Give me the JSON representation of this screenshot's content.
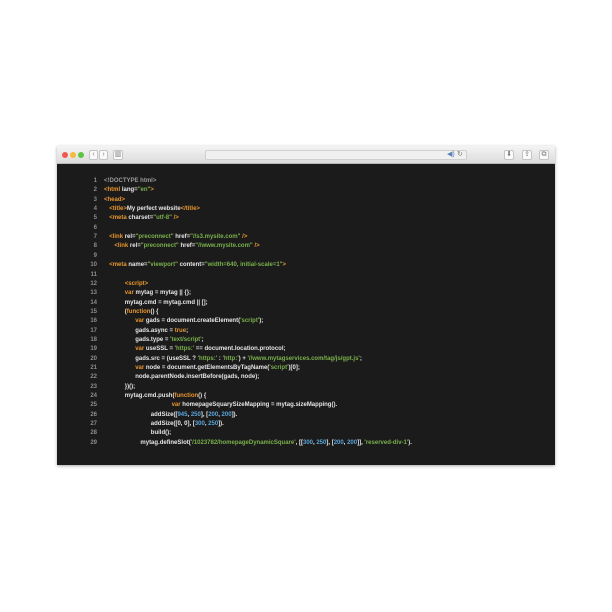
{
  "browser": {
    "controls": {
      "back": "‹",
      "forward": "›",
      "sidebar": "▥",
      "audio": "◀)",
      "reload": "↻",
      "download": "⬇",
      "share": "⇪",
      "tabs": "⧉"
    }
  },
  "colors": {
    "tag": "#e8962e",
    "string": "#79b14b",
    "number": "#5aa6d8",
    "text": "#e6e6e6",
    "line_number": "#8d8d8d",
    "background": "#1c1b1c"
  },
  "code_lines": [
    {
      "n": "1",
      "indent": 0,
      "tokens": [
        {
          "t": "doctype",
          "v": "<!DOCTYPE html>"
        }
      ]
    },
    {
      "n": "2",
      "indent": 0,
      "tokens": [
        {
          "t": "tag",
          "v": "<html "
        },
        {
          "t": "attr",
          "v": "lang="
        },
        {
          "t": "str",
          "v": "\"en\""
        },
        {
          "t": "tag",
          "v": ">"
        }
      ]
    },
    {
      "n": "3",
      "indent": 0,
      "tokens": [
        {
          "t": "tag",
          "v": "<head>"
        }
      ]
    },
    {
      "n": "4",
      "indent": 1,
      "tokens": [
        {
          "t": "tag",
          "v": "<title>"
        },
        {
          "t": "plain",
          "v": "My perfect website"
        },
        {
          "t": "tag",
          "v": "</title>"
        }
      ]
    },
    {
      "n": "5",
      "indent": 1,
      "tokens": [
        {
          "t": "tag",
          "v": "<meta "
        },
        {
          "t": "attr",
          "v": "charset="
        },
        {
          "t": "str",
          "v": "\"utf-8\""
        },
        {
          "t": "tag",
          "v": " />"
        }
      ]
    },
    {
      "n": "6",
      "indent": 0,
      "tokens": []
    },
    {
      "n": "7",
      "indent": 1,
      "tokens": [
        {
          "t": "tag",
          "v": "<link "
        },
        {
          "t": "attr",
          "v": "rel="
        },
        {
          "t": "str",
          "v": "\"preconnect\""
        },
        {
          "t": "attr",
          "v": " href="
        },
        {
          "t": "str",
          "v": "\"//s3.mysite.com\""
        },
        {
          "t": "tag",
          "v": " />"
        }
      ]
    },
    {
      "n": "8",
      "indent": 2,
      "tokens": [
        {
          "t": "tag",
          "v": "<link "
        },
        {
          "t": "attr",
          "v": "rel="
        },
        {
          "t": "str",
          "v": "\"preconnect\""
        },
        {
          "t": "attr",
          "v": " href="
        },
        {
          "t": "str",
          "v": "\"//www.mysite.com\""
        },
        {
          "t": "tag",
          "v": " />"
        }
      ]
    },
    {
      "n": "9",
      "indent": 0,
      "tokens": []
    },
    {
      "n": "10",
      "indent": 1,
      "tokens": [
        {
          "t": "tag",
          "v": "<meta "
        },
        {
          "t": "attr",
          "v": "name="
        },
        {
          "t": "str",
          "v": "\"viewport\""
        },
        {
          "t": "attr",
          "v": " content="
        },
        {
          "t": "str",
          "v": "\"width=640, initial-scale=1\""
        },
        {
          "t": "tag",
          "v": ">"
        }
      ]
    },
    {
      "n": "11",
      "indent": 0,
      "tokens": []
    },
    {
      "n": "12",
      "indent": 4,
      "tokens": [
        {
          "t": "tag",
          "v": "<script>"
        }
      ]
    },
    {
      "n": "13",
      "indent": 4,
      "tokens": [
        {
          "t": "kw",
          "v": "var "
        },
        {
          "t": "plain",
          "v": "mytag = mytag || {};"
        }
      ]
    },
    {
      "n": "14",
      "indent": 4,
      "tokens": [
        {
          "t": "plain",
          "v": "mytag.cmd = mytag.cmd || [];"
        }
      ]
    },
    {
      "n": "15",
      "indent": 4,
      "tokens": [
        {
          "t": "plain",
          "v": "("
        },
        {
          "t": "kw",
          "v": "function"
        },
        {
          "t": "plain",
          "v": "() {"
        }
      ]
    },
    {
      "n": "16",
      "indent": 6,
      "tokens": [
        {
          "t": "kw",
          "v": "var "
        },
        {
          "t": "plain",
          "v": "gads = document.createElement("
        },
        {
          "t": "str",
          "v": "'script'"
        },
        {
          "t": "plain",
          "v": ");"
        }
      ]
    },
    {
      "n": "17",
      "indent": 6,
      "tokens": [
        {
          "t": "plain",
          "v": "gads.async = "
        },
        {
          "t": "kw",
          "v": "true"
        },
        {
          "t": "plain",
          "v": ";"
        }
      ]
    },
    {
      "n": "18",
      "indent": 6,
      "tokens": [
        {
          "t": "plain",
          "v": "gads.type = "
        },
        {
          "t": "str",
          "v": "'text/script'"
        },
        {
          "t": "plain",
          "v": ";"
        }
      ]
    },
    {
      "n": "19",
      "indent": 6,
      "tokens": [
        {
          "t": "kw",
          "v": "var "
        },
        {
          "t": "plain",
          "v": "useSSL = "
        },
        {
          "t": "str",
          "v": "'https:'"
        },
        {
          "t": "plain",
          "v": " == document.location.protocol;"
        }
      ]
    },
    {
      "n": "20",
      "indent": 6,
      "tokens": [
        {
          "t": "plain",
          "v": "gads.src = (useSSL ? "
        },
        {
          "t": "str",
          "v": "'https:'"
        },
        {
          "t": "plain",
          "v": " : "
        },
        {
          "t": "str",
          "v": "'http:'"
        },
        {
          "t": "plain",
          "v": ") + "
        },
        {
          "t": "str",
          "v": "'//www.mytagservices.com/tag/js/gpt.js'"
        },
        {
          "t": "plain",
          "v": ";"
        }
      ]
    },
    {
      "n": "21",
      "indent": 6,
      "tokens": [
        {
          "t": "kw",
          "v": "var "
        },
        {
          "t": "plain",
          "v": "node = document.getElementsByTagName("
        },
        {
          "t": "str",
          "v": "'script'"
        },
        {
          "t": "plain",
          "v": ")[0];"
        }
      ]
    },
    {
      "n": "22",
      "indent": 6,
      "tokens": [
        {
          "t": "plain",
          "v": "node.parentNode.insertBefore(gads, node);"
        }
      ]
    },
    {
      "n": "23",
      "indent": 4,
      "tokens": [
        {
          "t": "plain",
          "v": "})();"
        }
      ]
    },
    {
      "n": "24",
      "indent": 4,
      "tokens": [
        {
          "t": "plain",
          "v": "mytag.cmd.push("
        },
        {
          "t": "kw",
          "v": "function"
        },
        {
          "t": "plain",
          "v": "() {"
        }
      ]
    },
    {
      "n": "25",
      "indent": 13,
      "tokens": [
        {
          "t": "kw",
          "v": "var "
        },
        {
          "t": "plain",
          "v": "homepageSquarySizeMapping = mytag.sizeMapping()."
        }
      ]
    },
    {
      "n": "26",
      "indent": 9,
      "tokens": [
        {
          "t": "plain",
          "v": "addSize(["
        },
        {
          "t": "num",
          "v": "945"
        },
        {
          "t": "plain",
          "v": ", "
        },
        {
          "t": "num",
          "v": "250"
        },
        {
          "t": "plain",
          "v": "], ["
        },
        {
          "t": "num",
          "v": "200"
        },
        {
          "t": "plain",
          "v": ", "
        },
        {
          "t": "num",
          "v": "200"
        },
        {
          "t": "plain",
          "v": "])."
        }
      ]
    },
    {
      "n": "27",
      "indent": 9,
      "tokens": [
        {
          "t": "plain",
          "v": "addSize([0, 0], ["
        },
        {
          "t": "num",
          "v": "300"
        },
        {
          "t": "plain",
          "v": ", "
        },
        {
          "t": "num",
          "v": "250"
        },
        {
          "t": "plain",
          "v": "])."
        }
      ]
    },
    {
      "n": "28",
      "indent": 9,
      "tokens": [
        {
          "t": "plain",
          "v": "build();"
        }
      ]
    },
    {
      "n": "29",
      "indent": 7,
      "tokens": [
        {
          "t": "plain",
          "v": "mytag.defineSlot("
        },
        {
          "t": "str",
          "v": "'/1023782/homepageDynamicSquare'"
        },
        {
          "t": "plain",
          "v": ", [["
        },
        {
          "t": "num",
          "v": "300"
        },
        {
          "t": "plain",
          "v": ", "
        },
        {
          "t": "num",
          "v": "250"
        },
        {
          "t": "plain",
          "v": "], ["
        },
        {
          "t": "num",
          "v": "200"
        },
        {
          "t": "plain",
          "v": ", "
        },
        {
          "t": "num",
          "v": "200"
        },
        {
          "t": "plain",
          "v": "]], "
        },
        {
          "t": "str",
          "v": "'reserved-div-1'"
        },
        {
          "t": "plain",
          "v": ")."
        }
      ]
    }
  ]
}
